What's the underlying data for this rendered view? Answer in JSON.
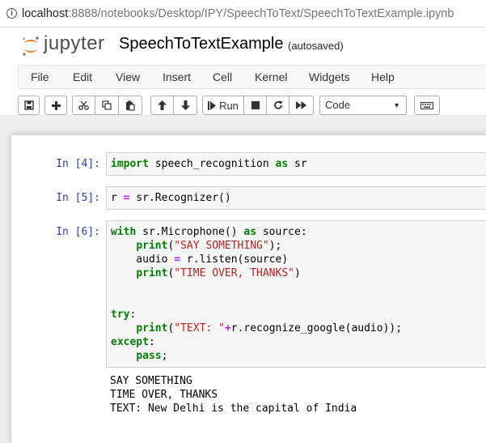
{
  "browser": {
    "url_host": "localhost",
    "url_rest": ":8888/notebooks/Desktop/IPY/SpeechToText/SpeechToTextExample.ipynb"
  },
  "header": {
    "logo_text": "jupyter",
    "notebook_title": "SpeechToTextExample",
    "autosave_status": "(autosaved)"
  },
  "menu": [
    "File",
    "Edit",
    "View",
    "Insert",
    "Cell",
    "Kernel",
    "Widgets",
    "Help"
  ],
  "toolbar": {
    "run_label": "Run",
    "cell_type": "Code",
    "icons": [
      "save-icon",
      "plus-icon",
      "cut-icon",
      "copy-icon",
      "paste-icon",
      "arrow-up-icon",
      "arrow-down-icon",
      "run-icon",
      "stop-icon",
      "restart-icon",
      "fast-forward-icon",
      "keyboard-icon"
    ]
  },
  "cells": [
    {
      "prompt": "In [4]:",
      "code": "import speech_recognition as sr"
    },
    {
      "prompt": "In [5]:",
      "code": "r = sr.Recognizer()"
    },
    {
      "prompt": "In [6]:",
      "code": "with sr.Microphone() as source:\n    print(\"SAY SOMETHING\");\n    audio = r.listen(source)\n    print(\"TIME OVER, THANKS\")\n\n\ntry:\n    print(\"TEXT: \"+r.recognize_google(audio));\nexcept:\n    pass;",
      "output": "SAY SOMETHING\nTIME OVER, THANKS\nTEXT: New Delhi is the capital of India"
    }
  ],
  "colors": {
    "prompt": "#303f9f",
    "keyword": "#008000",
    "string": "#ba2121",
    "logo_orange": "#f37726"
  }
}
